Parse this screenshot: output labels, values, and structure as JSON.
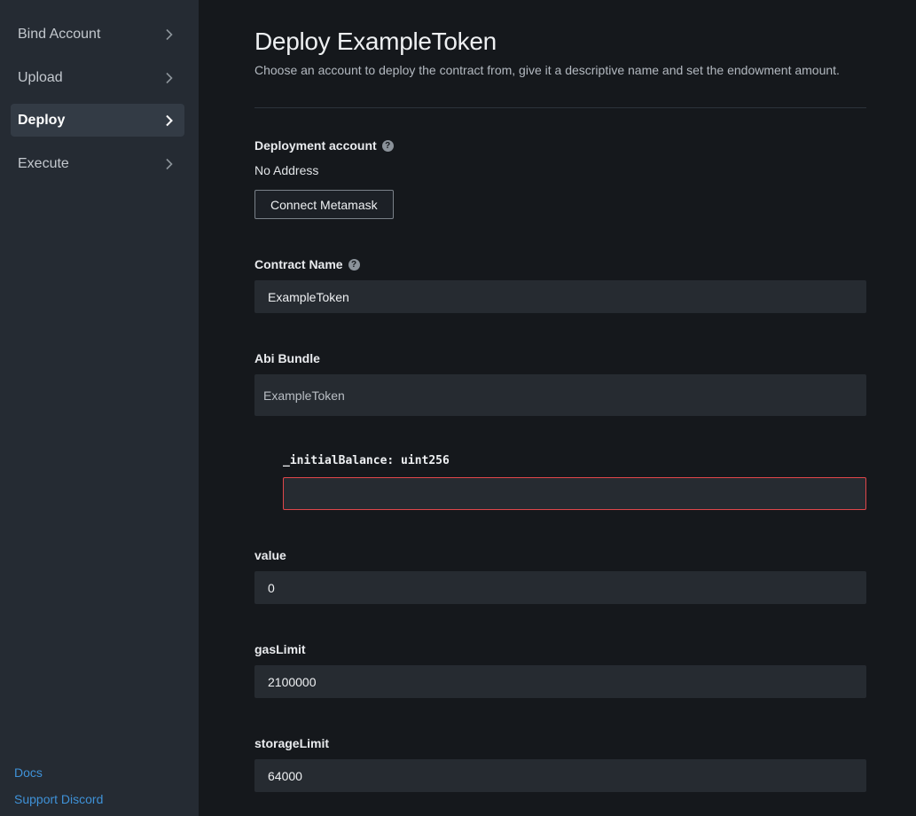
{
  "sidebar": {
    "items": [
      {
        "label": "Bind Account",
        "active": false
      },
      {
        "label": "Upload",
        "active": false
      },
      {
        "label": "Deploy",
        "active": true
      },
      {
        "label": "Execute",
        "active": false
      }
    ],
    "links": {
      "docs": "Docs",
      "support": "Support Discord"
    }
  },
  "page": {
    "title": "Deploy ExampleToken",
    "subtitle": "Choose an account to deploy the contract from, give it a descriptive name and set the endowment amount."
  },
  "deployment_account": {
    "label": "Deployment account",
    "help_icon": "question-circle-icon",
    "address": "No Address",
    "connect_button": "Connect Metamask"
  },
  "contract_name": {
    "label": "Contract Name",
    "value": "ExampleToken"
  },
  "abi_bundle": {
    "label": "Abi Bundle",
    "selected": "ExampleToken"
  },
  "constructor_args": {
    "initial_balance_label": "_initialBalance: uint256",
    "initial_balance_value": ""
  },
  "value": {
    "label": "value",
    "value": "0"
  },
  "gas_limit": {
    "label": "gasLimit",
    "value": "2100000"
  },
  "storage_limit": {
    "label": "storageLimit",
    "value": "64000"
  },
  "colors": {
    "accent_link": "#3f92d8",
    "error_border": "#e0464a",
    "sidebar_bg": "#252b33",
    "main_bg": "#15181c"
  }
}
